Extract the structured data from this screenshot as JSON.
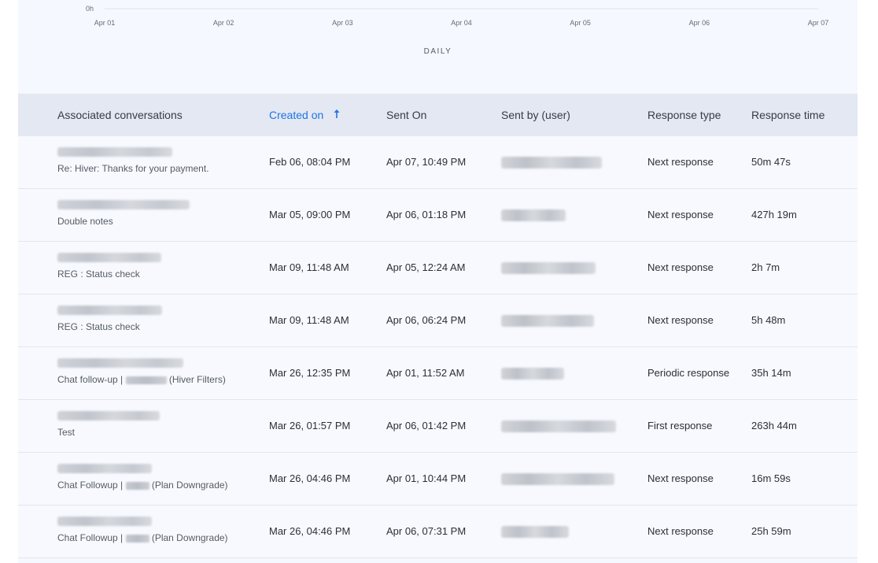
{
  "chart": {
    "y_label": "0h",
    "x_ticks": [
      "Apr 01",
      "Apr 02",
      "Apr 03",
      "Apr 04",
      "Apr 05",
      "Apr 06",
      "Apr 07"
    ],
    "period_label": "DAILY"
  },
  "table": {
    "columns": {
      "conversations": "Associated conversations",
      "created_on": "Created on",
      "sent_on": "Sent On",
      "sent_by": "Sent by (user)",
      "response_type": "Response type",
      "response_time": "Response time"
    },
    "sort_color": "#1f73e6",
    "rows": [
      {
        "subject_prefix": "Re: Hiver: Thanks for your payment.",
        "subject_suffix": "",
        "created_on": "Feb 06, 08:04 PM",
        "sent_on": "Apr 07, 10:49 PM",
        "response_type": "Next response",
        "response_time": "50m 47s"
      },
      {
        "subject_prefix": "Double notes",
        "subject_suffix": "",
        "created_on": "Mar 05, 09:00 PM",
        "sent_on": "Apr 06, 01:18 PM",
        "response_type": "Next response",
        "response_time": "427h 19m"
      },
      {
        "subject_prefix": "REG : Status check",
        "subject_suffix": "",
        "created_on": "Mar 09, 11:48 AM",
        "sent_on": "Apr 05, 12:24 AM",
        "response_type": "Next response",
        "response_time": "2h 7m"
      },
      {
        "subject_prefix": "REG : Status check",
        "subject_suffix": "",
        "created_on": "Mar 09, 11:48 AM",
        "sent_on": "Apr 06, 06:24 PM",
        "response_type": "Next response",
        "response_time": "5h 48m"
      },
      {
        "subject_prefix": "Chat follow-up | ",
        "subject_suffix": " (Hiver Filters)",
        "created_on": "Mar 26, 12:35 PM",
        "sent_on": "Apr 01, 11:52 AM",
        "response_type": "Periodic response",
        "response_time": "35h 14m"
      },
      {
        "subject_prefix": "Test",
        "subject_suffix": "",
        "created_on": "Mar 26, 01:57 PM",
        "sent_on": "Apr 06, 01:42 PM",
        "response_type": "First response",
        "response_time": "263h 44m"
      },
      {
        "subject_prefix": "Chat Followup | ",
        "subject_suffix": " (Plan Downgrade)",
        "created_on": "Mar 26, 04:46 PM",
        "sent_on": "Apr 01, 10:44 PM",
        "response_type": "Next response",
        "response_time": "16m 59s"
      },
      {
        "subject_prefix": "Chat Followup | ",
        "subject_suffix": " (Plan Downgrade)",
        "created_on": "Mar 26, 04:46 PM",
        "sent_on": "Apr 06, 07:31 PM",
        "response_type": "Next response",
        "response_time": "25h 59m"
      }
    ]
  }
}
